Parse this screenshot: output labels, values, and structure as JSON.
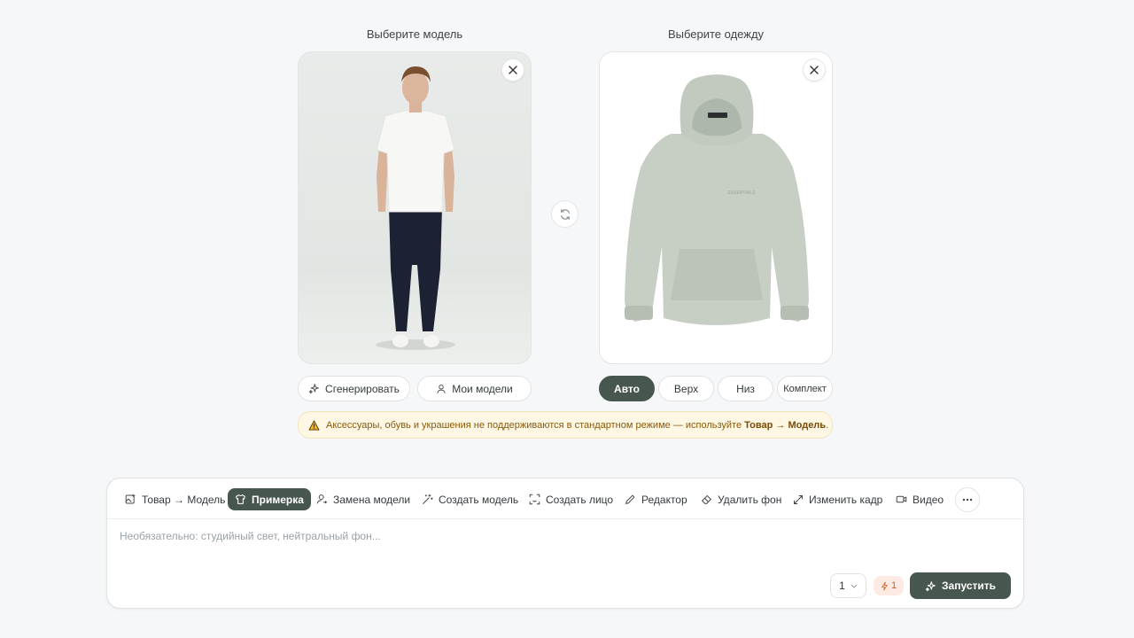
{
  "model_column": {
    "title": "Выберите модель",
    "generate_label": "Сгенерировать",
    "my_models_label": "Мои модели"
  },
  "clothing_column": {
    "title": "Выберите одежду",
    "hoodie_print": "ESSENTIALS",
    "filters": [
      {
        "label": "Авто",
        "active": true
      },
      {
        "label": "Верх",
        "active": false
      },
      {
        "label": "Низ",
        "active": false
      },
      {
        "label": "Комплект",
        "active": false
      }
    ]
  },
  "warning": {
    "text": "Аксессуары, обувь и украшения не поддерживаются в стандартном режиме — используйте",
    "link": "Товар → Модель",
    "suffix": "."
  },
  "toolbar": {
    "tools": [
      {
        "label": "Товар → Модель",
        "icon": "image-plus-icon",
        "active": false
      },
      {
        "label": "Примерка",
        "icon": "shirt-icon",
        "active": true
      },
      {
        "label": "Замена модели",
        "icon": "user-swap-icon",
        "active": false
      },
      {
        "label": "Создать модель",
        "icon": "magic-wand-icon",
        "active": false
      },
      {
        "label": "Создать лицо",
        "icon": "face-scan-icon",
        "active": false
      },
      {
        "label": "Редактор",
        "icon": "pencil-icon",
        "active": false
      },
      {
        "label": "Удалить фон",
        "icon": "eraser-icon",
        "active": false
      },
      {
        "label": "Изменить кадр",
        "icon": "expand-icon",
        "active": false
      },
      {
        "label": "Видео",
        "icon": "video-icon",
        "active": false
      }
    ]
  },
  "prompt": {
    "placeholder": "Необязательно: студийный свет, нейтральный фон..."
  },
  "footer": {
    "count_value": "1",
    "cost_value": "1",
    "run_label": "Запустить"
  },
  "colors": {
    "accent": "#47574f",
    "warning_bg": "#fdf7e4",
    "warning_text": "#8a5a0a",
    "cost_bg": "#fdebe3",
    "cost_text": "#c06030"
  }
}
